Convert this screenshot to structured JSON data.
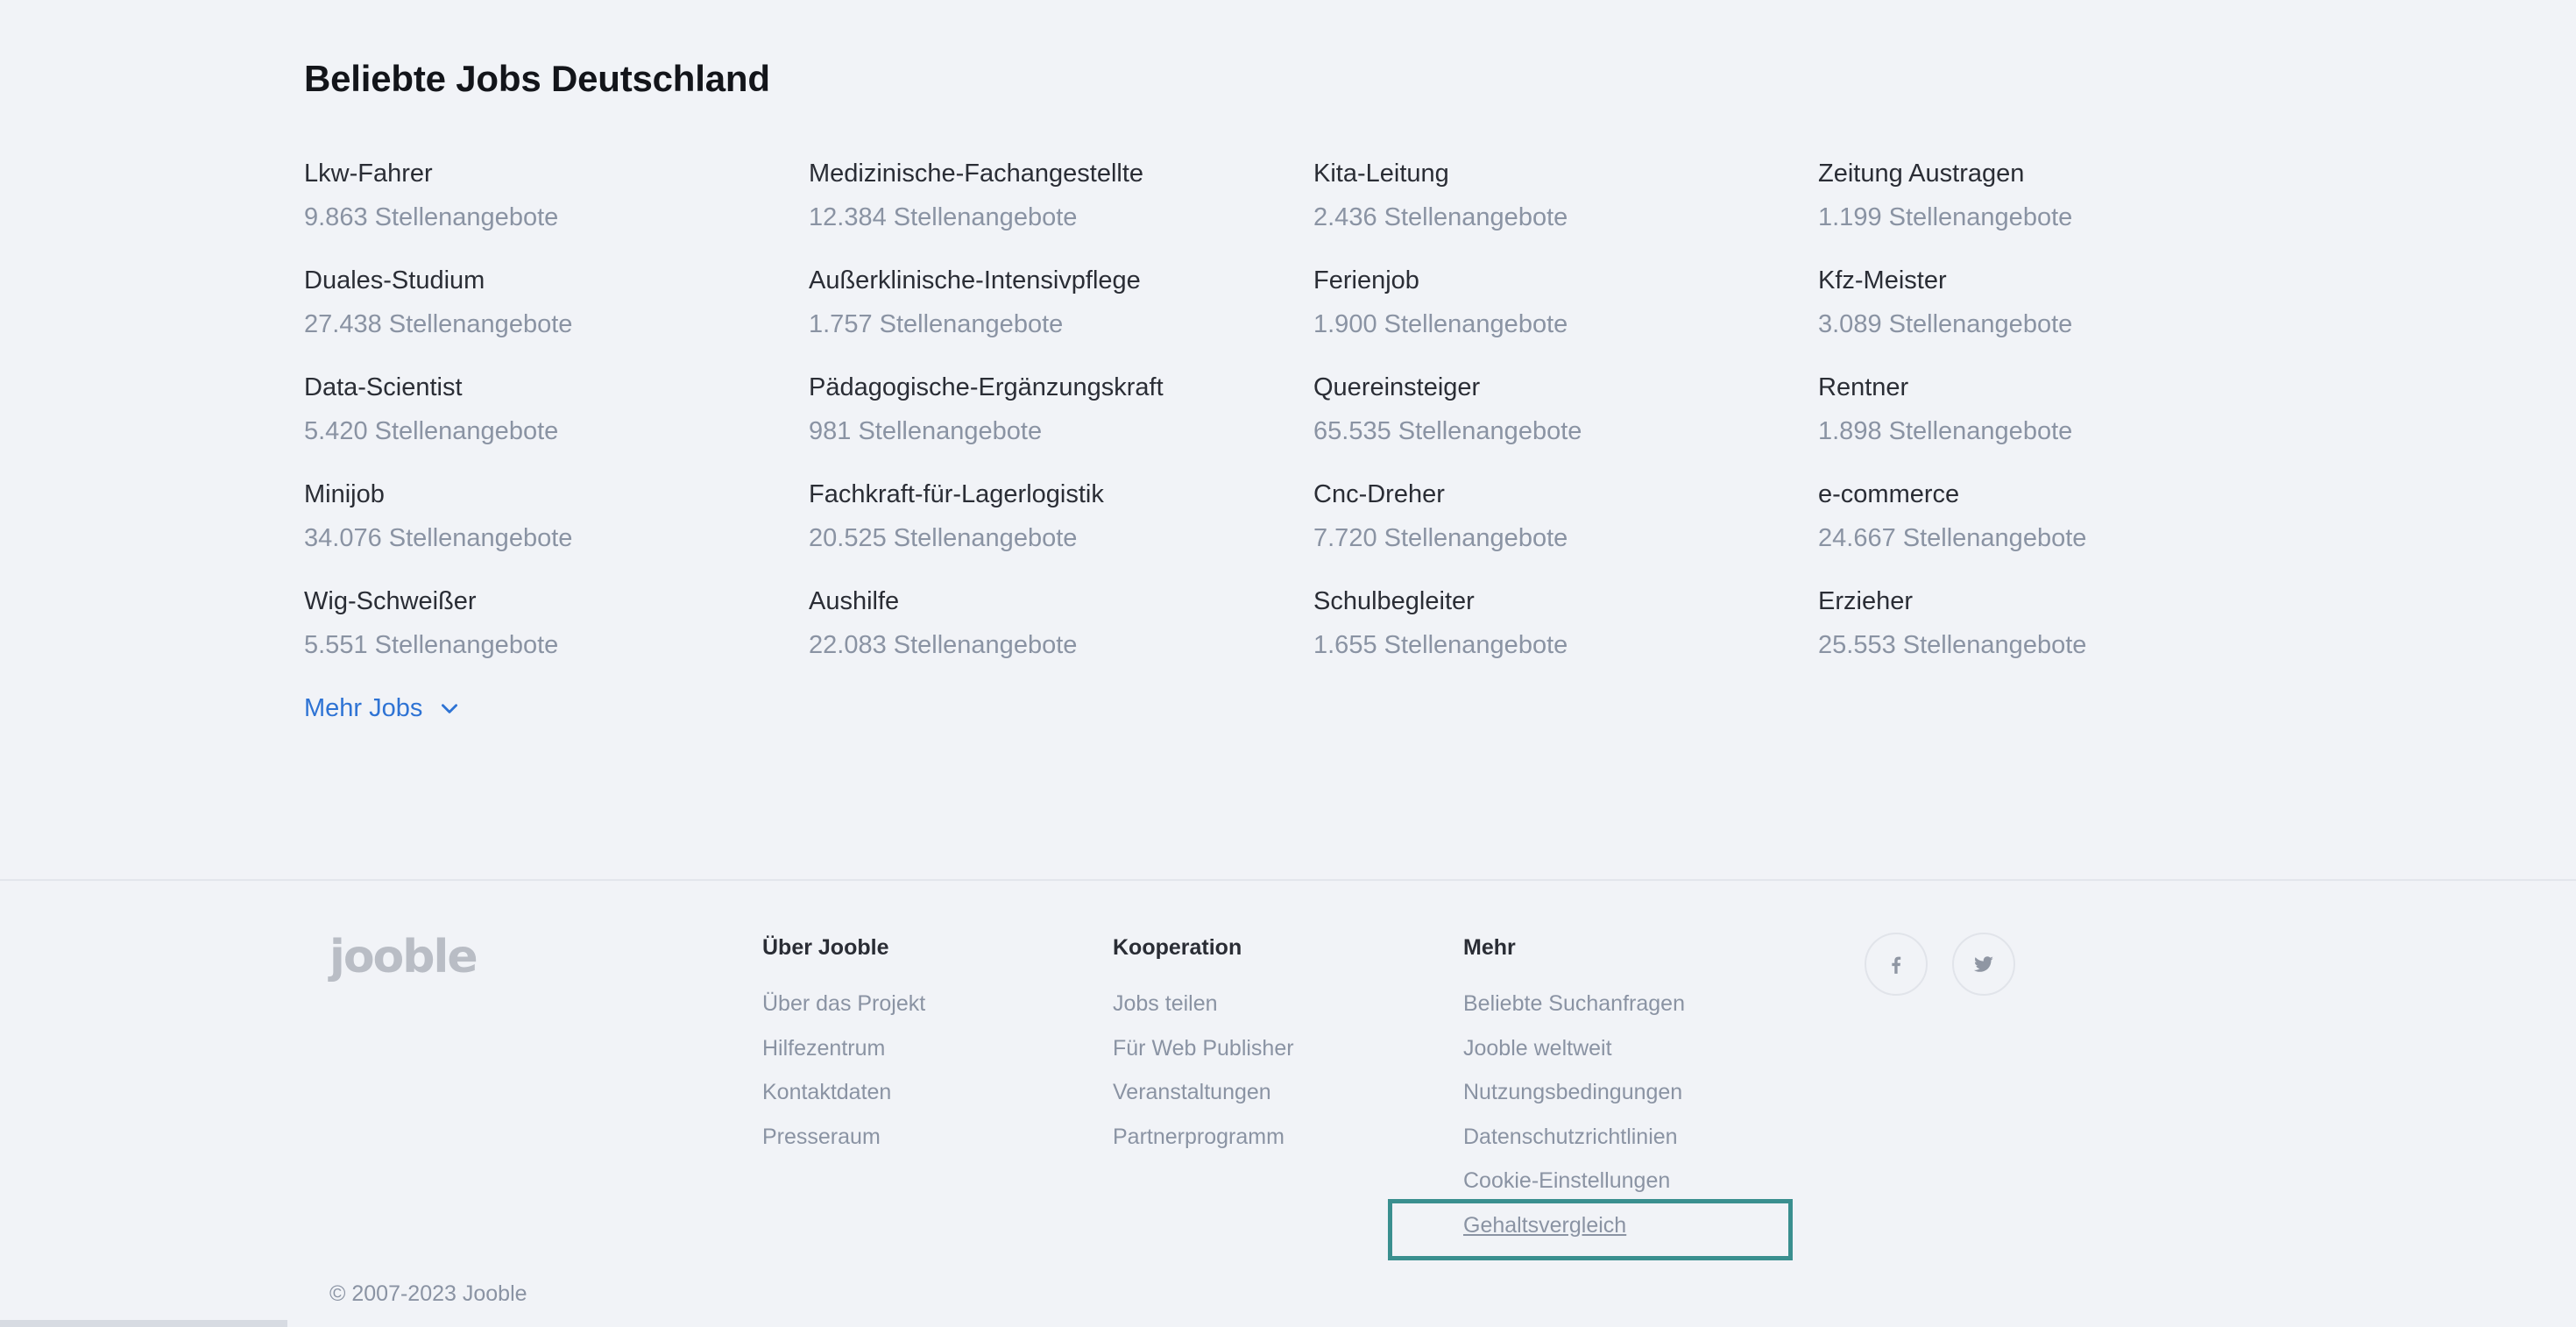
{
  "jobs": {
    "title": "Beliebte Jobs Deutschland",
    "items": [
      {
        "name": "Lkw-Fahrer",
        "count": "9.863 Stellenangebote"
      },
      {
        "name": "Medizinische-Fachangestellte",
        "count": "12.384 Stellenangebote"
      },
      {
        "name": "Kita-Leitung",
        "count": "2.436 Stellenangebote"
      },
      {
        "name": "Zeitung Austragen",
        "count": "1.199 Stellenangebote"
      },
      {
        "name": "Duales-Studium",
        "count": "27.438 Stellenangebote"
      },
      {
        "name": "Außerklinische-Intensivpflege",
        "count": "1.757 Stellenangebote"
      },
      {
        "name": "Ferienjob",
        "count": "1.900 Stellenangebote"
      },
      {
        "name": "Kfz-Meister",
        "count": "3.089 Stellenangebote"
      },
      {
        "name": "Data-Scientist",
        "count": "5.420 Stellenangebote"
      },
      {
        "name": "Pädagogische-Ergänzungskraft",
        "count": "981 Stellenangebote"
      },
      {
        "name": "Quereinsteiger",
        "count": "65.535 Stellenangebote"
      },
      {
        "name": "Rentner",
        "count": "1.898 Stellenangebote"
      },
      {
        "name": "Minijob",
        "count": "34.076 Stellenangebote"
      },
      {
        "name": "Fachkraft-für-Lagerlogistik",
        "count": "20.525 Stellenangebote"
      },
      {
        "name": "Cnc-Dreher",
        "count": "7.720 Stellenangebote"
      },
      {
        "name": "e-commerce",
        "count": "24.667 Stellenangebote"
      },
      {
        "name": "Wig-Schweißer",
        "count": "5.551 Stellenangebote"
      },
      {
        "name": "Aushilfe",
        "count": "22.083 Stellenangebote"
      },
      {
        "name": "Schulbegleiter",
        "count": "1.655 Stellenangebote"
      },
      {
        "name": "Erzieher",
        "count": "25.553 Stellenangebote"
      }
    ],
    "more_label": "Mehr Jobs"
  },
  "footer": {
    "logo": "jooble",
    "about": {
      "heading": "Über Jooble",
      "links": [
        "Über das Projekt",
        "Hilfezentrum",
        "Kontaktdaten",
        "Presseraum"
      ]
    },
    "coop": {
      "heading": "Kooperation",
      "links": [
        "Jobs teilen",
        "Für Web Publisher",
        "Veranstaltungen",
        "Partnerprogramm"
      ]
    },
    "more": {
      "heading": "Mehr",
      "links": [
        "Beliebte Suchanfragen",
        "Jooble weltweit",
        "Nutzungsbedingungen",
        "Datenschutzrichtlinien",
        "Cookie-Einstellungen",
        "Gehaltsvergleich"
      ]
    },
    "social": [
      "facebook-icon",
      "twitter-icon"
    ],
    "copyright": "© 2007-2023 Jooble"
  },
  "colors": {
    "background": "#f1f3f7",
    "link_blue": "#2e73d4",
    "muted_text": "#8a93a3",
    "highlight": "#3a8f8f"
  }
}
